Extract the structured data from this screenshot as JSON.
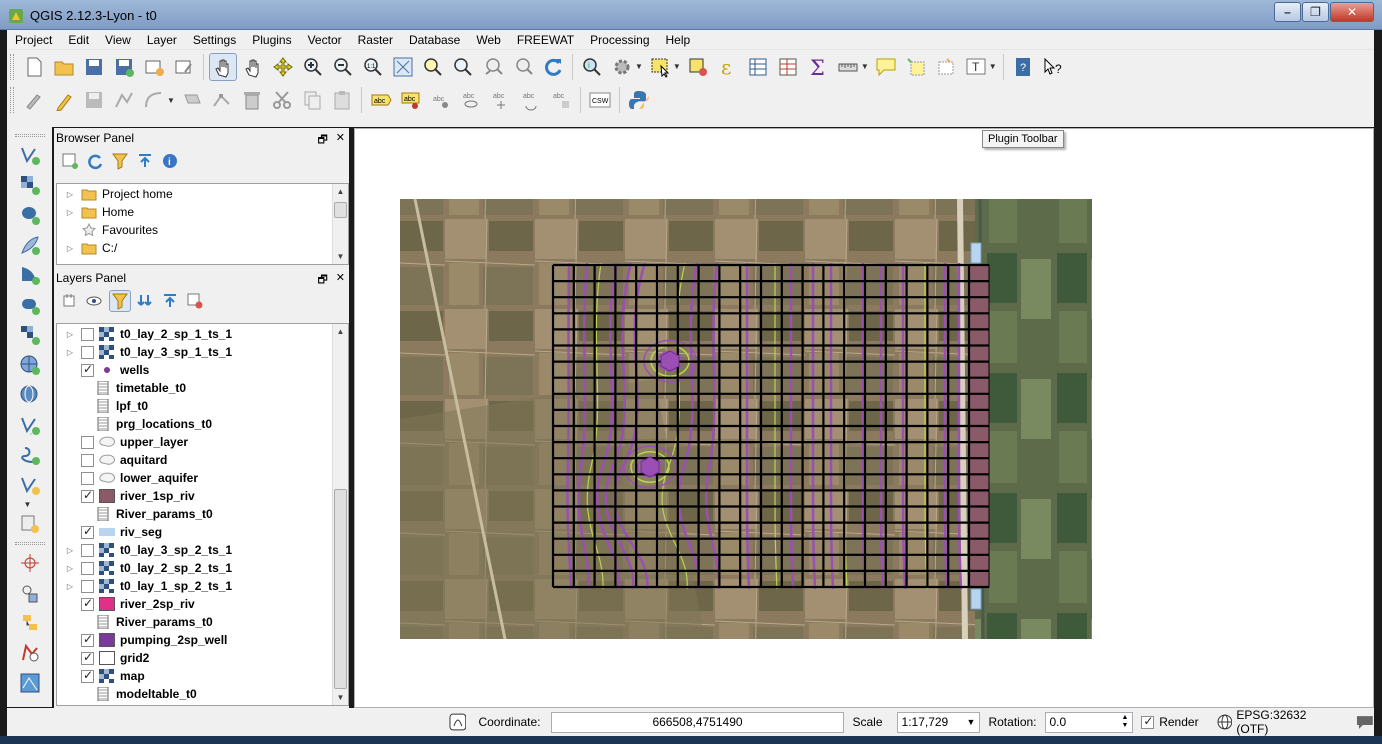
{
  "window": {
    "title": "QGIS 2.12.3-Lyon - t0"
  },
  "menu": [
    "Project",
    "Edit",
    "View",
    "Layer",
    "Settings",
    "Plugins",
    "Vector",
    "Raster",
    "Database",
    "Web",
    "FREEWAT",
    "Processing",
    "Help"
  ],
  "browser_panel": {
    "title": "Browser Panel",
    "items": [
      "Project home",
      "Home",
      "Favourites",
      "C:/"
    ]
  },
  "layers_panel": {
    "title": "Layers Panel",
    "layers": [
      {
        "name": "t0_lay_2_sp_1_ts_1",
        "checked": false,
        "expandable": true,
        "icon": "raster-icon"
      },
      {
        "name": "t0_lay_3_sp_1_ts_1",
        "checked": false,
        "expandable": true,
        "icon": "raster-icon"
      },
      {
        "name": "wells",
        "checked": true,
        "expandable": false,
        "icon": "point-icon"
      },
      {
        "name": "timetable_t0",
        "checked": null,
        "expandable": false,
        "icon": "table-icon"
      },
      {
        "name": "lpf_t0",
        "checked": null,
        "expandable": false,
        "icon": "table-icon"
      },
      {
        "name": "prg_locations_t0",
        "checked": null,
        "expandable": false,
        "icon": "table-icon"
      },
      {
        "name": "upper_layer",
        "checked": false,
        "expandable": false,
        "icon": "polygon-outline-icon"
      },
      {
        "name": "aquitard",
        "checked": false,
        "expandable": false,
        "icon": "polygon-outline-icon"
      },
      {
        "name": "lower_aquifer",
        "checked": false,
        "expandable": false,
        "icon": "polygon-outline-icon"
      },
      {
        "name": "river_1sp_riv",
        "checked": true,
        "expandable": false,
        "icon": "fill-icon",
        "color": "#8a5a68"
      },
      {
        "name": "River_params_t0",
        "checked": null,
        "expandable": false,
        "icon": "table-icon"
      },
      {
        "name": "riv_seg",
        "checked": true,
        "expandable": false,
        "icon": "line-icon",
        "color": "#b8d4f0"
      },
      {
        "name": "t0_lay_3_sp_2_ts_1",
        "checked": false,
        "expandable": true,
        "icon": "raster-icon"
      },
      {
        "name": "t0_lay_2_sp_2_ts_1",
        "checked": false,
        "expandable": true,
        "icon": "raster-icon"
      },
      {
        "name": "t0_lay_1_sp_2_ts_1",
        "checked": false,
        "expandable": true,
        "icon": "raster-icon"
      },
      {
        "name": "river_2sp_riv",
        "checked": true,
        "expandable": false,
        "icon": "fill-icon",
        "color": "#e0308a"
      },
      {
        "name": "River_params_t0",
        "checked": null,
        "expandable": false,
        "icon": "table-icon"
      },
      {
        "name": "pumping_2sp_well",
        "checked": true,
        "expandable": false,
        "icon": "fill-icon",
        "color": "#7a3a9a"
      },
      {
        "name": "grid2",
        "checked": true,
        "expandable": false,
        "icon": "fill-icon",
        "color": "#ffffff"
      },
      {
        "name": "map",
        "checked": true,
        "expandable": false,
        "icon": "raster-icon"
      },
      {
        "name": "modeltable_t0",
        "checked": null,
        "expandable": false,
        "icon": "table-icon"
      }
    ]
  },
  "tooltip": "Plugin Toolbar",
  "status": {
    "coordinate_label": "Coordinate:",
    "coordinate_value": "666508,4751490",
    "scale_label": "Scale",
    "scale_value": "1:17,729",
    "rotation_label": "Rotation:",
    "rotation_value": "0.0",
    "render_label": "Render",
    "render_checked": true,
    "crs": "EPSG:32632 (OTF)"
  },
  "colors": {
    "contour": "#9b4fb5",
    "contour_light": "#b9d64a",
    "river_cells": "#8a5a68",
    "grid": "#000000"
  }
}
